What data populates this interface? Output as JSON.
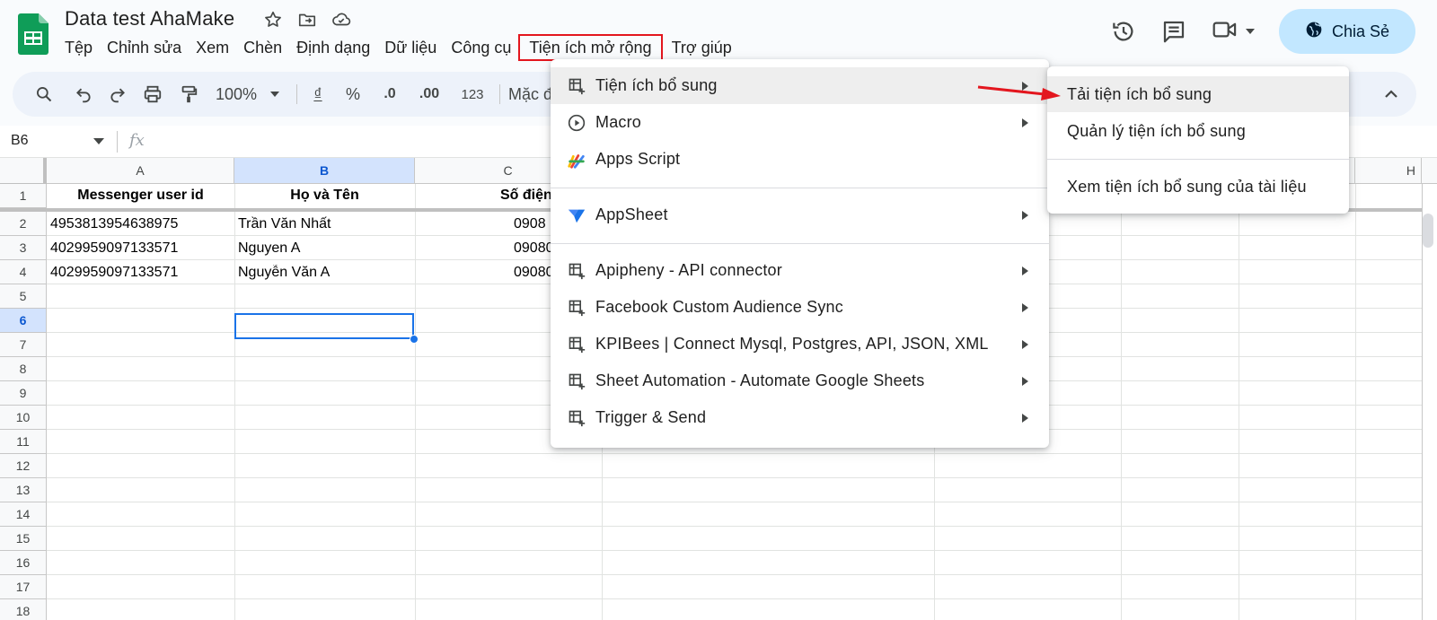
{
  "header": {
    "title": "Data test AhaMake",
    "menus": [
      "Tệp",
      "Chỉnh sửa",
      "Xem",
      "Chèn",
      "Định dạng",
      "Dữ liệu",
      "Công cụ",
      "Tiện ích mở rộng",
      "Trợ giúp"
    ],
    "share_label": "Chia Sẻ"
  },
  "toolbar": {
    "zoom": "100%",
    "currency": "₫",
    "percent": "%",
    "dec_decrease": ".0",
    "dec_increase": ".00",
    "format_number": "123",
    "font_partial": "Mặc đ"
  },
  "formula_bar": {
    "cell_ref": "B6",
    "fx": "fx"
  },
  "grid": {
    "columns": [
      "A",
      "B",
      "C",
      "H"
    ],
    "rows": [
      "1",
      "2",
      "3",
      "4",
      "5",
      "6",
      "7",
      "8",
      "9",
      "10",
      "11",
      "12",
      "13",
      "14",
      "15",
      "16",
      "17",
      "18"
    ],
    "selected_cell": "B6",
    "headers": {
      "a": "Messenger user id",
      "b": "Họ và Tên",
      "c": "Số điện"
    },
    "data": [
      {
        "a": "4953813954638975",
        "b": "Trần Văn Nhất",
        "c": "0908"
      },
      {
        "a": "4029959097133571",
        "b": "Nguyen A",
        "c": "09080"
      },
      {
        "a": "4029959097133571",
        "b": "Nguyễn Văn A",
        "c": "09080"
      }
    ]
  },
  "extensions_menu": {
    "items": [
      {
        "label": "Tiện ích bổ sung",
        "icon": "addon-icon",
        "submenu": true,
        "active": true
      },
      {
        "label": "Macro",
        "icon": "play-circle-icon",
        "submenu": true
      },
      {
        "label": "Apps Script",
        "icon": "apps-script-icon",
        "submenu": false
      },
      {
        "label": "AppSheet",
        "icon": "appsheet-icon",
        "submenu": true
      },
      {
        "label": "Apipheny - API connector",
        "icon": "addon-icon",
        "submenu": true
      },
      {
        "label": "Facebook Custom Audience Sync",
        "icon": "addon-icon",
        "submenu": true
      },
      {
        "label": "KPIBees | Connect Mysql, Postgres, API, JSON, XML",
        "icon": "addon-icon",
        "submenu": true
      },
      {
        "label": "Sheet Automation - Automate Google Sheets",
        "icon": "addon-icon",
        "submenu": true
      },
      {
        "label": "Trigger & Send",
        "icon": "addon-icon",
        "submenu": true
      }
    ]
  },
  "addons_submenu": {
    "items": [
      {
        "label": "Tải tiện ích bổ sung",
        "active": true
      },
      {
        "label": "Quản lý tiện ích bổ sung"
      },
      {
        "label": "Xem tiện ích bổ sung của tài liệu"
      }
    ]
  },
  "colors": {
    "accent": "#1a73e8",
    "share_bg": "#c2e7ff",
    "highlight_border": "#e3161e",
    "annotation_arrow": "#e3161e"
  }
}
